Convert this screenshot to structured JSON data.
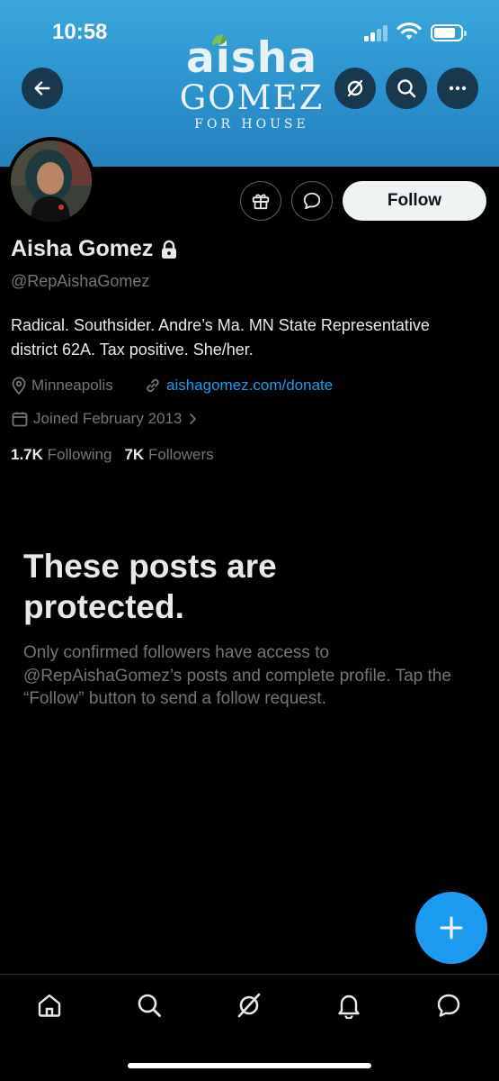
{
  "status_bar": {
    "time": "10:58"
  },
  "banner": {
    "logo_first": "aisha",
    "logo_last": "GOMEZ",
    "logo_sub": "FOR HOUSE",
    "background_color": "#2b8fcb"
  },
  "profile": {
    "name": "Aisha Gomez",
    "handle": "@RepAishaGomez",
    "bio": "Radical. Southsider. Andre’s Ma. MN State Representative district 62A. Tax positive. She/her.",
    "location": "Minneapolis",
    "website": "aishagomez.com/donate",
    "joined": "Joined February 2013",
    "following_count": "1.7K",
    "following_label": "Following",
    "followers_count": "7K",
    "followers_label": "Followers",
    "follow_button": "Follow"
  },
  "protected": {
    "title": "These posts are protected.",
    "body": "Only confirmed followers have access to @RepAishaGomez’s posts and complete profile. Tap the “Follow” button to send a follow request."
  },
  "colors": {
    "accent": "#1d9bf0",
    "muted": "#71767b",
    "text": "#e7e9ea"
  },
  "icons": [
    "back-arrow-icon",
    "hide-icon",
    "search-icon",
    "more-icon",
    "gift-icon",
    "message-icon",
    "lock-icon",
    "location-icon",
    "link-icon",
    "calendar-icon",
    "chevron-right-icon",
    "plus-icon",
    "home-icon",
    "explore-icon",
    "grok-icon",
    "notifications-icon",
    "messages-icon"
  ]
}
